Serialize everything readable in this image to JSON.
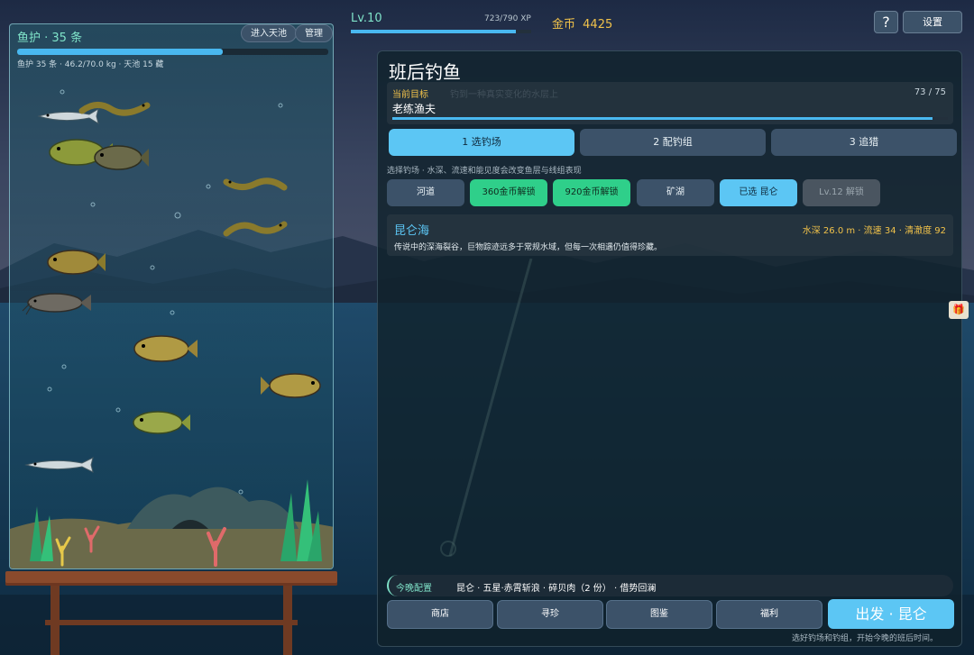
{
  "tank": {
    "title": "鱼护 · 35 条",
    "enter_pool_label": "进入天池",
    "manage_label": "管理",
    "stats": "鱼护 35 条 · 46.2/70.0 kg · 天池 15 藏",
    "fill_fraction": 0.66
  },
  "hud": {
    "level": "Lv.10",
    "xp": "723/790 XP",
    "xp_fraction": 0.915,
    "coins_label": "金币",
    "coins_value": "4425",
    "help_label": "?",
    "settings_label": "设置"
  },
  "panel": {
    "title": "班后钓鱼",
    "goal": {
      "label": "当前目标",
      "ghost_text": "钓到一种真实变化的水层上",
      "count": "73 / 75",
      "name": "老练渔夫",
      "fraction": 0.973
    },
    "steps": [
      {
        "label": "1 选钓场",
        "active": true
      },
      {
        "label": "2 配钓组",
        "active": false
      },
      {
        "label": "3 追猎",
        "active": false
      }
    ],
    "hint": "选择钓场 · 水深、流速和能见度会改变鱼层与线组表现",
    "spots": [
      {
        "label": "河道",
        "style": "plain"
      },
      {
        "label": "360金币解锁",
        "style": "green"
      },
      {
        "label": "920金币解锁",
        "style": "green"
      },
      {
        "label": "矿湖",
        "style": "plain"
      },
      {
        "label": "已选 昆仑",
        "style": "blue"
      },
      {
        "label": "Lv.12 解锁",
        "style": "locked"
      }
    ],
    "spot_info": {
      "name": "昆仑海",
      "stats": "水深 26.0 m · 流速 34 · 清澈度 92",
      "description": "传说中的深海裂谷，巨物踪迹远多于常规水域，但每一次相遇仍值得珍藏。"
    },
    "config": {
      "label": "今晚配置",
      "value": "昆仑 · 五星·赤霄斩浪 · 碎贝肉（2 份） · 借势回澜"
    },
    "bottom_buttons": [
      "商店",
      "寻珍",
      "图鉴",
      "福利"
    ],
    "go_label": "出发 · 昆仑",
    "go_hint": "选好钓场和钓组，开始今晚的班后时间。"
  },
  "colors": {
    "accent_blue": "#5cc6f4",
    "accent_green": "#2fcf8a",
    "gold": "#f1c24a",
    "teal_text": "#7fe3c9"
  }
}
